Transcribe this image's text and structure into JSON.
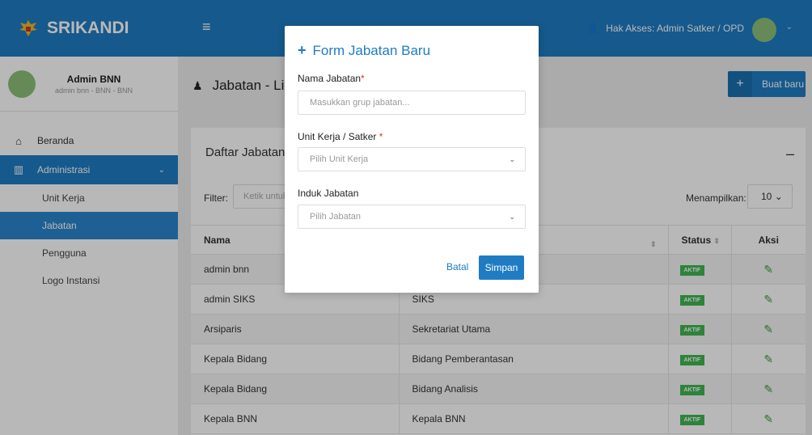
{
  "brand": {
    "name": "SRIKANDI"
  },
  "user": {
    "name": "Admin BNN",
    "sub": "admin bnn - BNN - BNN"
  },
  "header": {
    "hak_akses": "Hak Akses: Admin Satker / OPD"
  },
  "nav": {
    "beranda": "Beranda",
    "administrasi": "Administrasi",
    "sub": [
      "Unit Kerja",
      "Jabatan",
      "Pengguna",
      "Logo Instansi"
    ]
  },
  "page": {
    "title": "Jabatan - List",
    "new_button": "Buat baru"
  },
  "panel": {
    "title": "Daftar Jabatan",
    "filter_label": "Filter:",
    "filter_placeholder": "Ketik untuk",
    "show_label": "Menampilkan:",
    "show_value": "10"
  },
  "table": {
    "headers": [
      "Nama",
      "",
      "Status",
      "Aksi"
    ],
    "rows": [
      {
        "nama": "admin bnn",
        "unit": "",
        "status": "AKTIF"
      },
      {
        "nama": "admin SIKS",
        "unit": "SIKS",
        "status": "AKTIF"
      },
      {
        "nama": "Arsiparis",
        "unit": "Sekretariat Utama",
        "status": "AKTIF"
      },
      {
        "nama": "Kepala Bidang",
        "unit": "Bidang Pemberantasan",
        "status": "AKTIF"
      },
      {
        "nama": "Kepala Bidang",
        "unit": "Bidang Analisis",
        "status": "AKTIF"
      },
      {
        "nama": "Kepala BNN",
        "unit": "Kepala BNN",
        "status": "AKTIF"
      }
    ]
  },
  "modal": {
    "title": "Form Jabatan Baru",
    "nama_label": "Nama Jabatan",
    "nama_placeholder": "Masukkan grup jabatan...",
    "unit_label": "Unit Kerja / Satker",
    "unit_placeholder": "Pilih Unit Kerja",
    "induk_label": "Induk Jabatan",
    "induk_placeholder": "Pilih Jabatan",
    "cancel": "Batal",
    "save": "Simpan"
  },
  "colors": {
    "primary": "#1f7cc2",
    "success": "#41b653",
    "required": "#e0302b"
  }
}
